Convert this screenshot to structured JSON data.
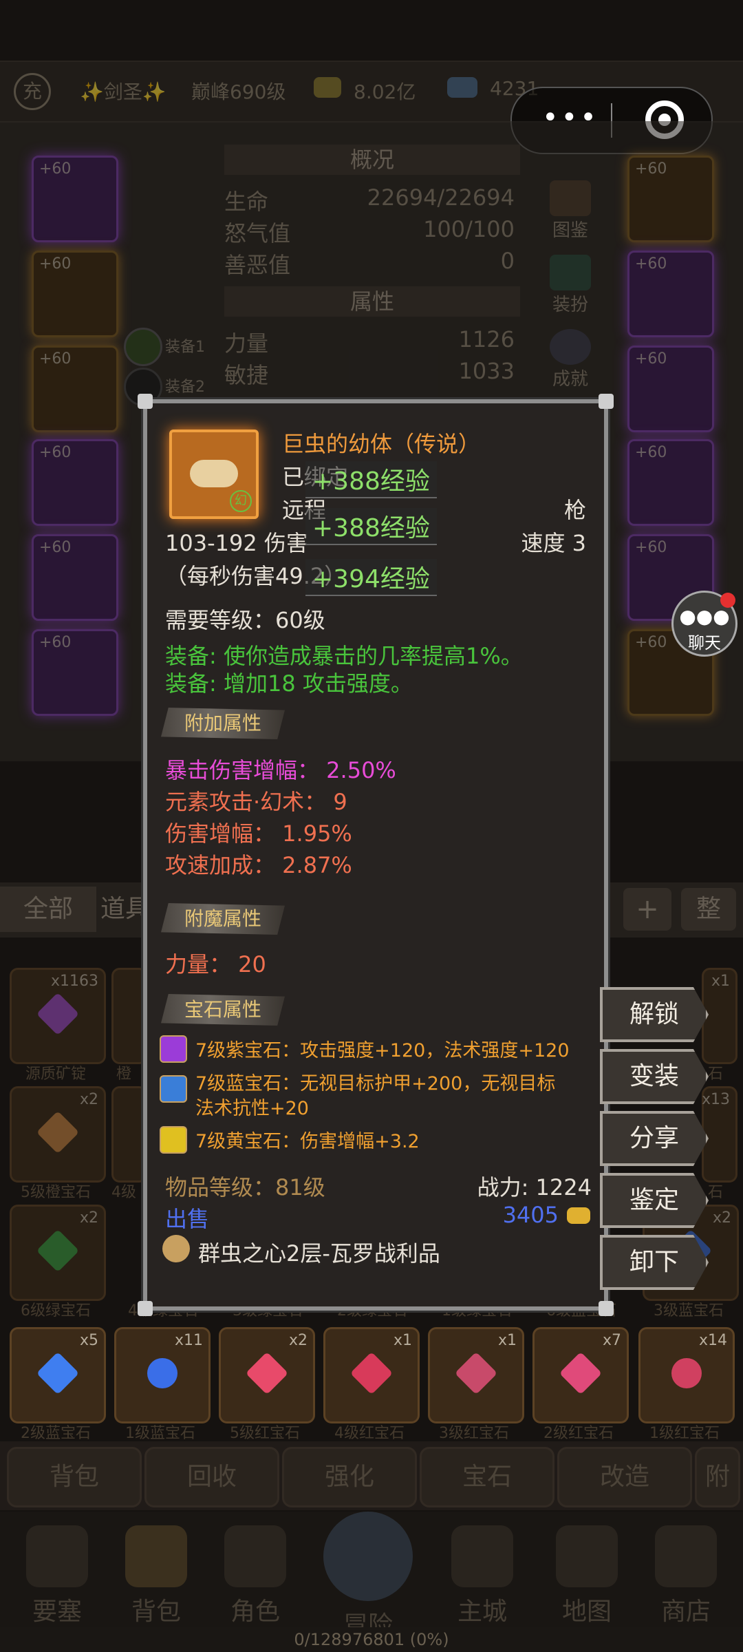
{
  "top_bar": {
    "title": "✨剑圣✨",
    "peak_level": "巅峰690级",
    "gold": "8.02亿",
    "diamonds": "4231"
  },
  "character": {
    "section_overview": "概况",
    "hp_label": "生命",
    "hp_value": "22694/22694",
    "rage_label": "怒气值",
    "rage_value": "100/100",
    "karma_label": "善恶值",
    "karma_value": "0",
    "section_attr": "属性",
    "str_label": "力量",
    "str_value": "1126",
    "agi_label": "敏捷",
    "agi_value": "1033",
    "equip1": "装备1",
    "equip2": "装备2",
    "side_buttons": [
      "图鉴",
      "装扮",
      "成就"
    ],
    "slot_level": "+60"
  },
  "tooltip": {
    "item_name": "巨虫的幼体（传说）",
    "bound": "已绑定",
    "range_type": "远程",
    "weapon_type": "枪",
    "damage": "103-192 伤害",
    "speed": "速度 3",
    "dps": "（每秒伤害49.2）",
    "float_xp": [
      "+388经验",
      "+388经验",
      "+394经验"
    ],
    "req_level": "需要等级：60级",
    "equip_effects": [
      "装备: 使你造成暴击的几率提高1%。",
      "装备: 增加18 攻击强度。"
    ],
    "extra_header": "附加属性",
    "extra_attrs": [
      {
        "text": "暴击伤害增幅：  2.50%",
        "color": "#e84cd8"
      },
      {
        "text": "元素攻击·幻术：  9",
        "color": "#f07050"
      },
      {
        "text": "伤害增幅：  1.95%",
        "color": "#f07050"
      },
      {
        "text": "攻速加成：  2.87%",
        "color": "#f07050"
      }
    ],
    "enchant_header": "附魔属性",
    "enchant": "力量：  20",
    "gem_header": "宝石属性",
    "gems": [
      {
        "text": "7级紫宝石：攻击强度+120，法术强度+120",
        "color": "#9b3cd8"
      },
      {
        "text": "7级蓝宝石：无视目标护甲+200，无视目标",
        "text2": "法术抗性+20",
        "color": "#3a7ed8"
      },
      {
        "text": "7级黄宝石：伤害增幅+3.2",
        "color": "#e0c020"
      }
    ],
    "item_level": "物品等级：81级",
    "power": "战力: 1224",
    "sell_label": "出售",
    "sell_price": "3405",
    "source": "群虫之心2层-瓦罗战利品",
    "icon_badge": "幻"
  },
  "actions": [
    "解锁",
    "变装",
    "分享",
    "鉴定",
    "卸下"
  ],
  "chat_label": "聊天",
  "inventory": {
    "tab_all": "全部",
    "tab_items": "道具",
    "row1_counts": [
      "x1163",
      "x1"
    ],
    "row1_labels": [
      "源质矿锭",
      "橙",
      "石"
    ],
    "row2_counts": [
      "x2",
      "x13"
    ],
    "row2_labels": [
      "5级橙宝石",
      "4级",
      "石"
    ],
    "row3_counts": [
      "x2",
      "x2"
    ],
    "row3_labels": [
      "6级绿宝石",
      "4级绿宝石",
      "3级绿宝石",
      "2级绿宝石",
      "1级绿宝石",
      "6级蓝宝石",
      "3级蓝宝石"
    ],
    "row4_counts": [
      "x5",
      "x11",
      "x2",
      "x1",
      "x1",
      "x7",
      "x14"
    ],
    "row4_labels": [
      "2级蓝宝石",
      "1级蓝宝石",
      "5级红宝石",
      "4级红宝石",
      "3级红宝石",
      "2级红宝石",
      "1级红宝石"
    ],
    "gem_colors": [
      "#3f7ef0",
      "#3a6ee8",
      "#e84a6a",
      "#d83a5a",
      "#c84a6a",
      "#e04a7a",
      "#d04060"
    ]
  },
  "bottom_tabs": [
    "背包",
    "回收",
    "强化",
    "宝石",
    "改造",
    "附"
  ],
  "nav": [
    "要塞",
    "背包",
    "角色",
    "冒险",
    "主城",
    "地图",
    "商店"
  ],
  "xp": "0/128976801 (0%)",
  "colors": {
    "tooltip_border": "#8f8f8f",
    "accent_orange": "#ef9a3c",
    "effect_green": "#49c43c"
  }
}
